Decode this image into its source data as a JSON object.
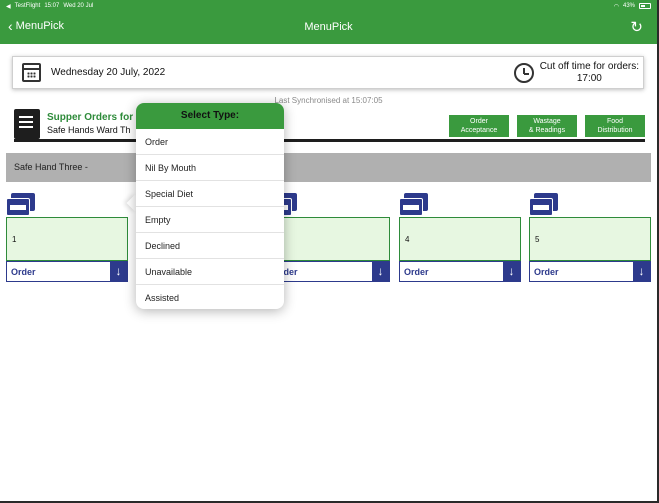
{
  "status_bar": {
    "app": "TestFlight",
    "time": "15:07",
    "date": "Wed 20 Jul",
    "battery": "43%"
  },
  "nav": {
    "back_label": "MenuPick",
    "title": "MenuPick"
  },
  "date_bar": {
    "date": "Wednesday 20 July, 2022",
    "cutoff_label": "Cut off time for orders:",
    "cutoff_time": "17:00"
  },
  "sync_text": "Last Synchronised at 15:07:05",
  "header": {
    "title": "Supper Orders for",
    "subtitle": "Safe Hands Ward Th"
  },
  "toolbar": [
    {
      "line1": "Order",
      "line2": "Acceptance"
    },
    {
      "line1": "Wastage",
      "line2": "& Readings"
    },
    {
      "line1": "Food",
      "line2": "Distribution"
    }
  ],
  "group": {
    "label": "Safe Hand Three -"
  },
  "beds": [
    {
      "number": "1",
      "order_label": "Order"
    },
    {
      "number": "",
      "order_label": "Order"
    },
    {
      "number": "4",
      "order_label": "Order"
    },
    {
      "number": "5",
      "order_label": "Order"
    }
  ],
  "popover": {
    "title": "Select Type:",
    "items": [
      "Order",
      "Nil By Mouth",
      "Special Diet",
      "Empty",
      "Declined",
      "Unavailable",
      "Assisted"
    ]
  },
  "colors": {
    "brand_green": "#3a9a3e",
    "bed_blue": "#2d3a8c",
    "card_bg": "#e7f7e1"
  }
}
